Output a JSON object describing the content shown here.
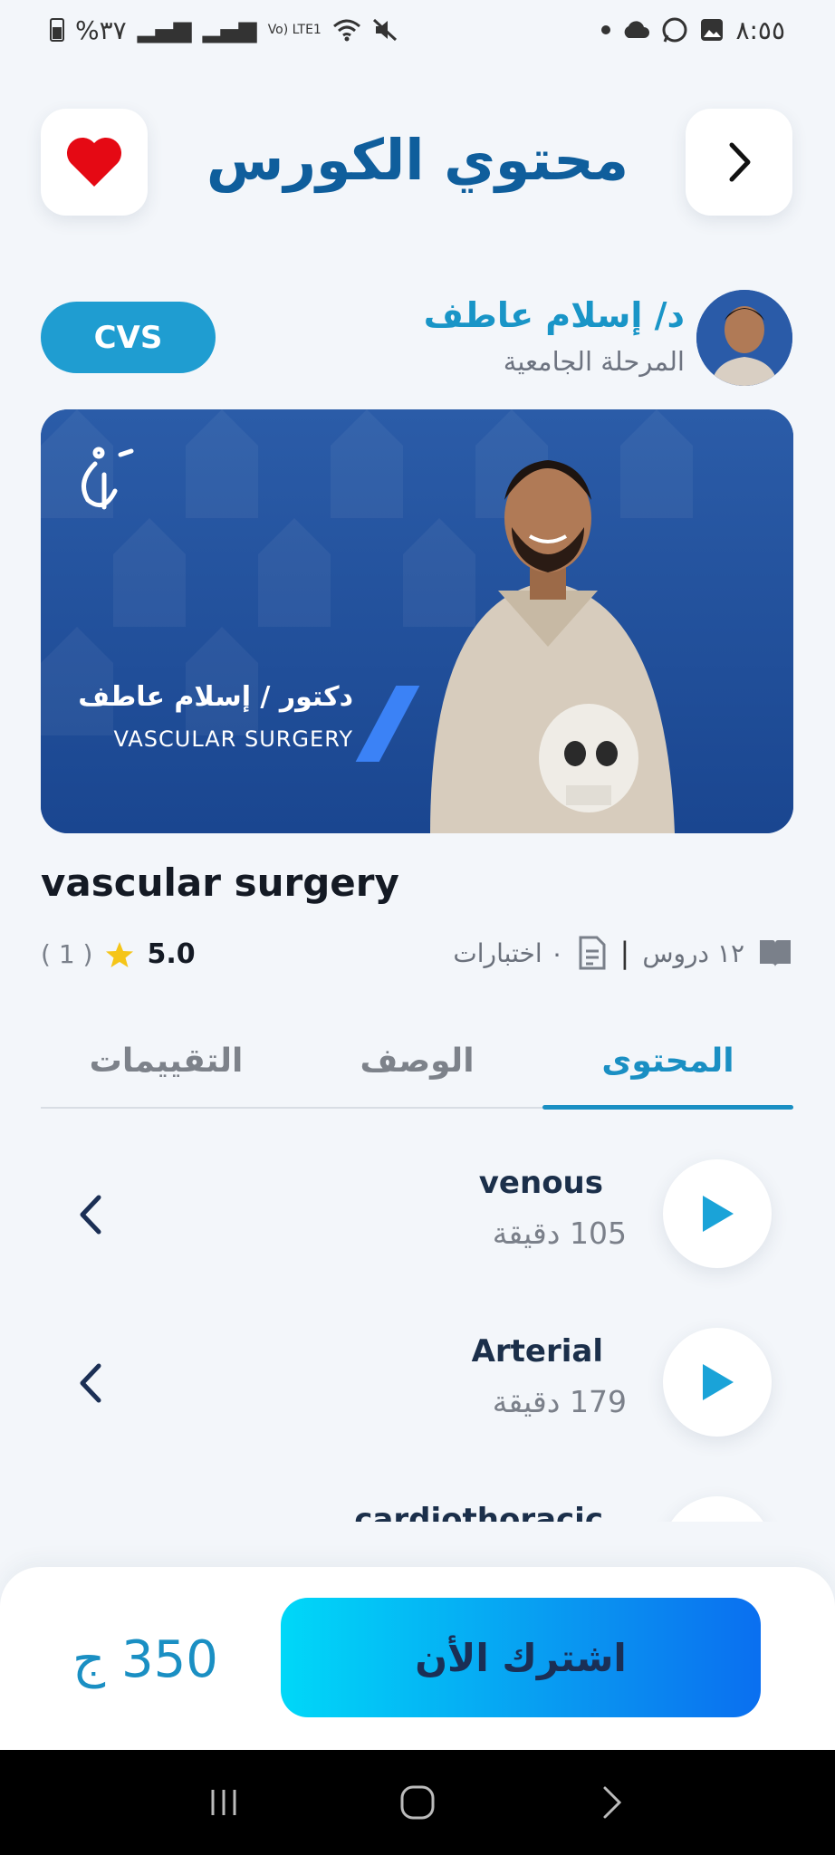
{
  "status_bar": {
    "time": "٨:٥٥",
    "battery": "%٣٧",
    "network": "Vo) LTE1"
  },
  "header": {
    "title": "محتوي الكورس"
  },
  "instructor": {
    "name": "د/ إسلام عاطف",
    "stage": "المرحلة الجامعية",
    "badge": "CVS"
  },
  "banner": {
    "name": "دكتور / إسلام عاطف",
    "subtitle": "VASCULAR SURGERY"
  },
  "course": {
    "title": "vascular surgery",
    "lessons_count": "١٢ دروس",
    "exams": "٠ اختبارات",
    "rating": "5.0",
    "rating_count": "( 1 )"
  },
  "tabs": [
    {
      "label": "المحتوى",
      "active": true
    },
    {
      "label": "الوصف",
      "active": false
    },
    {
      "label": "التقييمات",
      "active": false
    }
  ],
  "lessons": [
    {
      "title": "venous",
      "duration": "105 دقيقة"
    },
    {
      "title": "Arterial",
      "duration": "179 دقيقة"
    },
    {
      "title": "cardiothoracic",
      "duration": ""
    }
  ],
  "purchase": {
    "price": "350 ج",
    "subscribe_label": "اشترك الأن"
  },
  "colors": {
    "primary": "#0f5e9c",
    "accent": "#1a8fc3",
    "heart": "#e50914"
  }
}
